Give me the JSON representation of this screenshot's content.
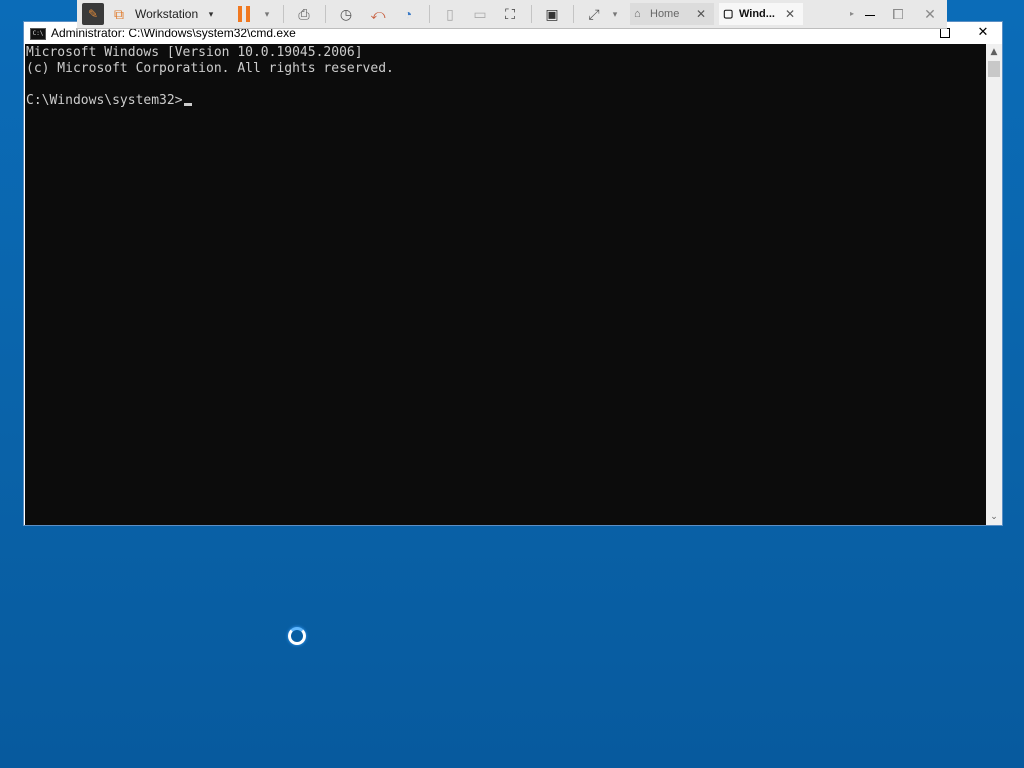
{
  "cmd_window": {
    "title": "Administrator: C:\\Windows\\system32\\cmd.exe",
    "app_icon_text": "C:\\",
    "console_lines": [
      "Microsoft Windows [Version 10.0.19045.2006]",
      "(c) Microsoft Corporation. All rights reserved.",
      "C:\\Windows\\system32>"
    ],
    "close_glyph": "✕",
    "scroll_up_glyph": "▲",
    "scroll_down_glyph": "⌄"
  },
  "vm_toolbar": {
    "workstation_label": "Workstation",
    "dropdown_glyph": "▾",
    "tabs": [
      {
        "label": "Home",
        "icon": "home-icon",
        "close": "✕"
      },
      {
        "label": "Wind...",
        "icon": "vm-icon",
        "close": "✕"
      }
    ]
  },
  "colors": {
    "desktop": "#0a63a9",
    "console_bg": "#0c0c0c",
    "console_fg": "#cccccc",
    "pause_accent": "#f07820"
  }
}
